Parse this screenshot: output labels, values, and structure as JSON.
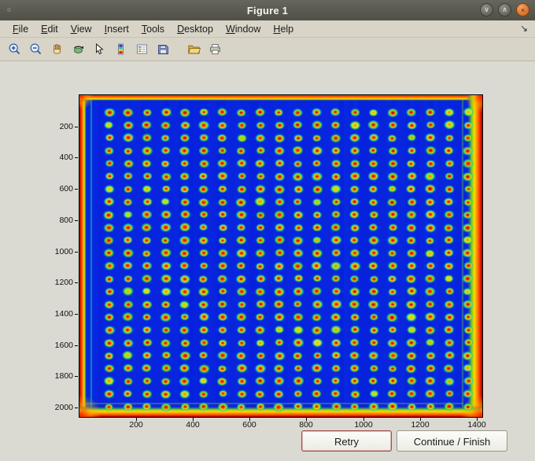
{
  "window": {
    "title": "Figure 1",
    "menu_icon_glyph": "○",
    "controls": {
      "minimize_glyph": "∨",
      "maximize_glyph": "∧",
      "close_glyph": "×"
    }
  },
  "menu_bar": {
    "items": [
      "File",
      "Edit",
      "View",
      "Insert",
      "Tools",
      "Desktop",
      "Window",
      "Help"
    ],
    "dock_glyph": "↘"
  },
  "toolbar": {
    "icons": [
      {
        "name": "zoom-in-icon"
      },
      {
        "name": "zoom-out-icon"
      },
      {
        "name": "pan-hand-icon"
      },
      {
        "name": "rotate-3d-icon"
      },
      {
        "name": "data-cursor-icon"
      },
      {
        "name": "colorbar-icon"
      },
      {
        "name": "legend-icon"
      },
      {
        "name": "save-icon"
      },
      {
        "name": "open-folder-icon",
        "gap": true
      },
      {
        "name": "print-icon"
      }
    ]
  },
  "buttons": {
    "retry": "Retry",
    "continue_finish": "Continue / Finish"
  },
  "chart_data": {
    "type": "heatmap",
    "title": "",
    "xlabel": "",
    "ylabel": "",
    "xlim": [
      0,
      1420
    ],
    "ylim": [
      0,
      2060
    ],
    "y_axis_direction": "reverse",
    "x_ticks": [
      200,
      400,
      600,
      800,
      1000,
      1200,
      1400
    ],
    "y_ticks": [
      200,
      400,
      600,
      800,
      1000,
      1200,
      1400,
      1600,
      1800,
      2000
    ],
    "colormap": "jet",
    "grid": false,
    "description": "Microarray slide scan shown with jet colormap: deep blue field, hot red/orange/yellow bands along all four image edges, thin green/cyan transition streaks, and a regular 20x24 grid of assay spots, each with a red-orange core, yellow-green ring and teal halo.",
    "spot_grid": {
      "rows": 24,
      "cols": 20,
      "x_start": 105,
      "x_end": 1370,
      "y_start": 110,
      "y_end": 1995
    },
    "colors": {
      "background": "#0722dd",
      "edge_hot": [
        "#8f0000",
        "#e82000",
        "#ff7700",
        "#ffdd00"
      ],
      "edge_transition": [
        "#66cc22",
        "#00ccaa"
      ],
      "spot_core": "#ff4400",
      "spot_center": "#bb0000",
      "spot_ring": "#c8e830",
      "spot_halo": "#22cc88"
    }
  }
}
